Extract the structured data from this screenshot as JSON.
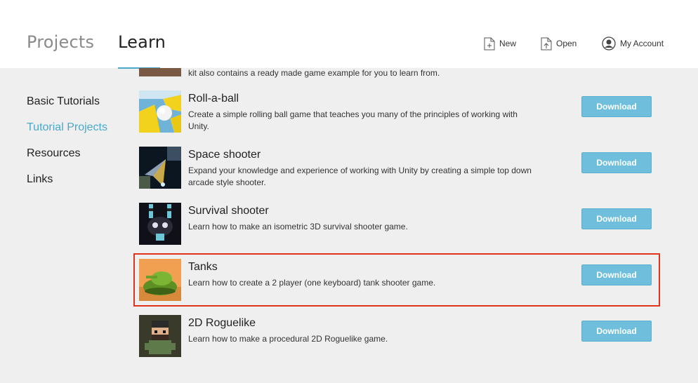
{
  "header": {
    "tabs": [
      {
        "label": "Projects"
      },
      {
        "label": "Learn"
      }
    ],
    "actions": {
      "new_label": "New",
      "open_label": "Open",
      "account_label": "My Account"
    }
  },
  "sidebar": {
    "items": [
      {
        "label": "Basic Tutorials"
      },
      {
        "label": "Tutorial Projects"
      },
      {
        "label": "Resources"
      },
      {
        "label": "Links"
      }
    ]
  },
  "list": {
    "partial_desc": "kit also contains a ready made game example for you to learn from.",
    "download_label": "Download",
    "items": [
      {
        "title": "Roll-a-ball",
        "desc": "Create a simple rolling ball game that teaches you many of the principles of working with Unity."
      },
      {
        "title": "Space shooter",
        "desc": "Expand your knowledge and experience of working with Unity by creating a simple top down arcade style shooter."
      },
      {
        "title": "Survival shooter",
        "desc": "Learn how to make an isometric 3D survival shooter game."
      },
      {
        "title": "Tanks",
        "desc": "Learn how to create a 2 player (one keyboard) tank shooter game."
      },
      {
        "title": "2D Roguelike",
        "desc": "Learn how to make a procedural 2D Roguelike game."
      }
    ]
  },
  "colors": {
    "accent": "#4aa9c9",
    "download_button": "#6fbfdc",
    "highlight": "#e0341c"
  }
}
